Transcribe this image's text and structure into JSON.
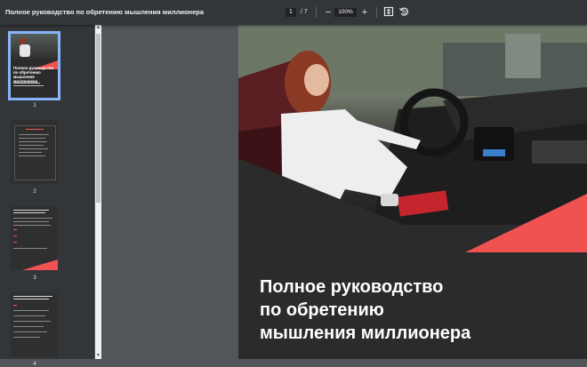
{
  "toolbar": {
    "title": "Полное руководство по обретению мышления миллионера",
    "current_page": "1",
    "page_separator": "/",
    "total_pages": "7",
    "zoom_out": "−",
    "zoom_level": "100%",
    "zoom_in": "+"
  },
  "sidebar": {
    "thumbnails": [
      {
        "label": "1",
        "title": "Полное руководство по обретению мышления миллионера",
        "selected": true
      },
      {
        "label": "2"
      },
      {
        "label": "3"
      },
      {
        "label": "4"
      }
    ]
  },
  "document": {
    "title_lines": [
      "Полное руководство",
      "по обретению",
      "мышления миллионера"
    ]
  },
  "colors": {
    "toolbar": "#323639",
    "viewer_bg": "#525659",
    "accent_red": "#f05252",
    "page_dark": "#2b2b2b"
  }
}
